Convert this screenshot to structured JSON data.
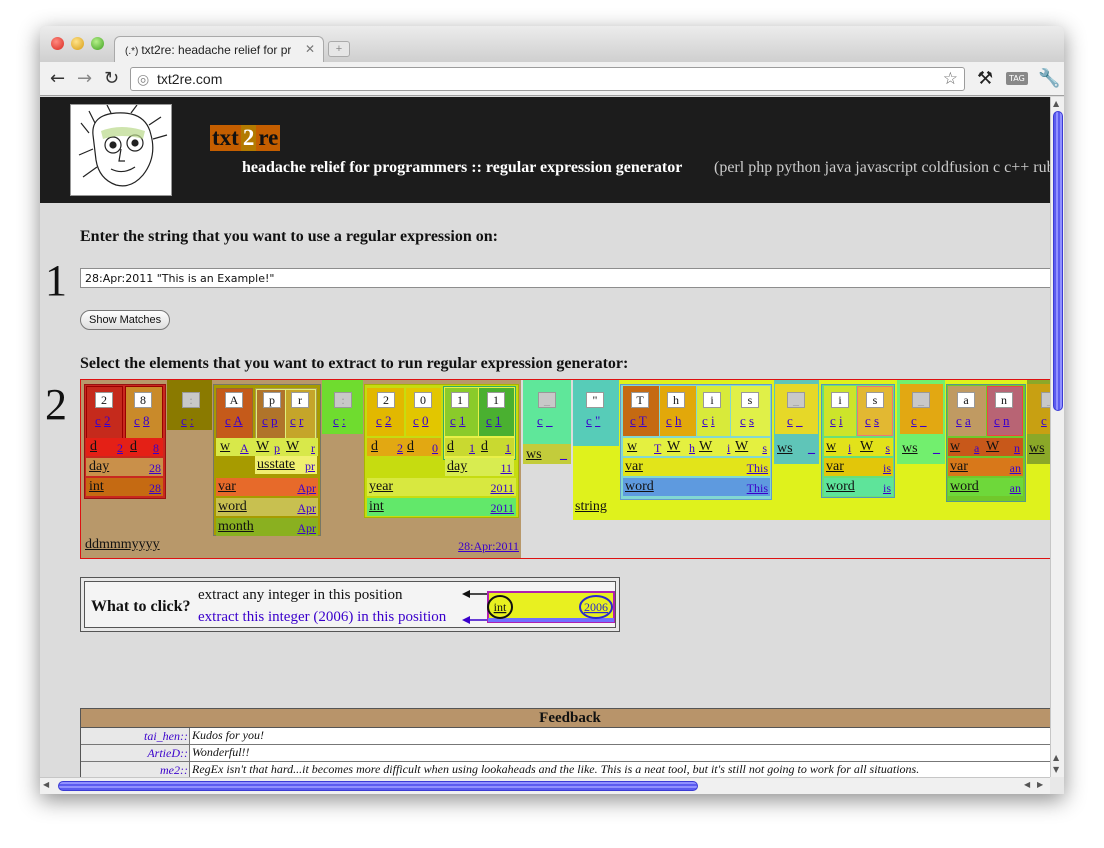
{
  "browser": {
    "tab_title": "txt2re: headache relief for pr",
    "tab_favicon": "(.*)",
    "new_tab": "+",
    "url": "txt2re.com"
  },
  "banner": {
    "brand_a": "txt",
    "brand_b": "2",
    "brand_c": "re",
    "tagline": "headache relief for programmers :: regular expression generator",
    "languages": "(perl php python java javascript coldfusion c c++ rub"
  },
  "step1": {
    "number": "1",
    "heading": "Enter the string that you want to use a regular expression on:",
    "input_value": "28:Apr:2011 \"This is an Example!\"",
    "button": "Show Matches"
  },
  "step2": {
    "number": "2",
    "heading": "Select the elements that you want to extract to run regular expression generator:",
    "chars": [
      "2",
      "8",
      ":",
      "A",
      "p",
      "r",
      ":",
      "2",
      "0",
      "1",
      "1",
      "_",
      "\"",
      "T",
      "h",
      "i",
      "s",
      "_",
      "i",
      "s",
      "_",
      "a",
      "n",
      "_"
    ],
    "t": {
      "c": "c",
      "d": "d",
      "w": "w",
      "W": "W",
      "i": "i",
      "h": "h",
      "s": "s",
      "a": "a",
      "n": "n",
      "n2": "2",
      "n8": "8",
      "n0": "0",
      "n1": "1",
      "colon": ":",
      "A": "A",
      "p": "p",
      "r": "r",
      "us": "_",
      "quote": "\"",
      "T": "T",
      "ws": "ws",
      "day": "day",
      "int": "int",
      "var": "var",
      "word": "word",
      "month": "month",
      "usstate": "usstate",
      "year": "year",
      "string": "string",
      "ddmmmyyyy": "ddmmmyyyy",
      "v28": "28",
      "vApr": "Apr",
      "vpr": "pr",
      "v2011": "2011",
      "v11": "11",
      "vThis": "This",
      "vis": "is",
      "van": "an",
      "vdate": "28:Apr:2011"
    }
  },
  "what_to_click": {
    "question": "What to click?",
    "line1": "extract any integer in this position",
    "line2": "extract this integer (2006) in this position",
    "demo_left": "int",
    "demo_right": "2006"
  },
  "feedback": {
    "title": "Feedback",
    "rows": [
      {
        "who": "tai_hen::",
        "msg": "Kudos for you!"
      },
      {
        "who": "ArtieD::",
        "msg": "Wonderful!!"
      },
      {
        "who": "me2::",
        "msg": "RegEx isn't that hard...it becomes more difficult when using lookaheads and the like. This is a neat tool, but it's still not going to work for all situations."
      }
    ]
  },
  "colors": {
    "banner_bg": "#1c1c1c",
    "brand_orange": "#c45e00",
    "link_purple": "#3a00cc",
    "scrollbar_blue": "#5b5bef",
    "matrix_border": "#dd1111"
  }
}
